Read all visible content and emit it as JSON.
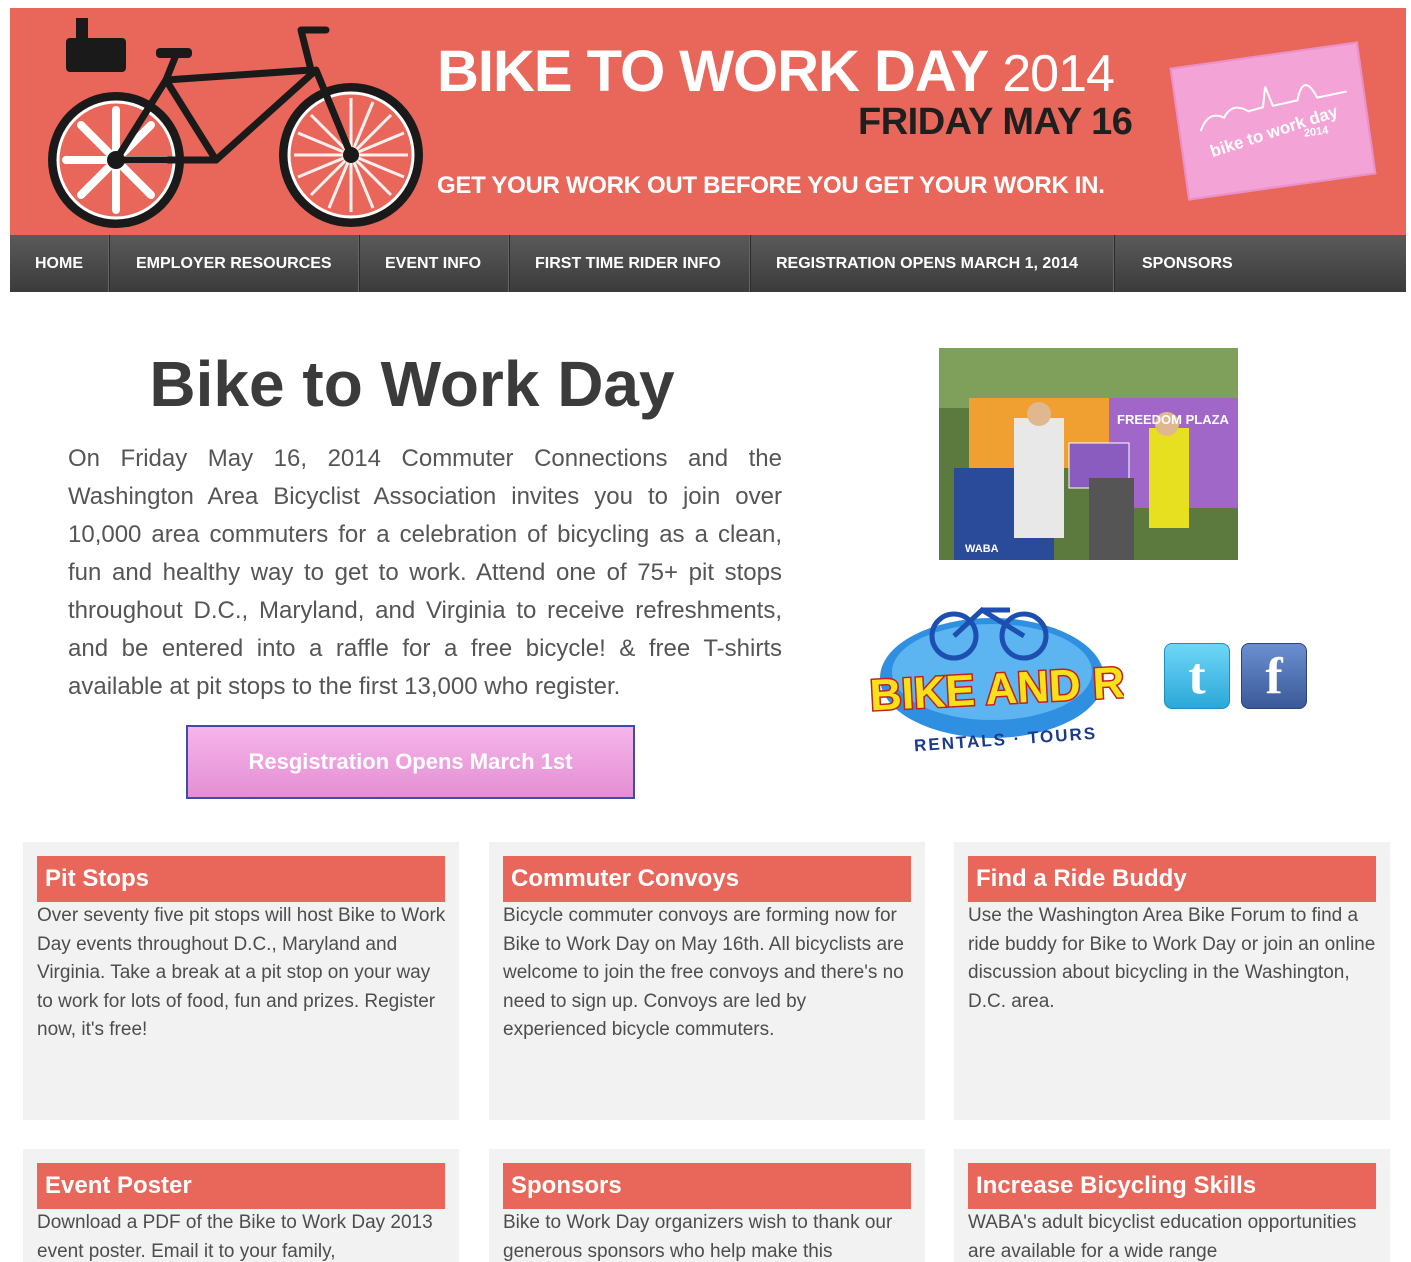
{
  "banner": {
    "title": "BIKE TO WORK DAY",
    "year": "2014",
    "date": "FRIDAY MAY 16",
    "tagline": "GET YOUR WORK OUT BEFORE YOU GET YOUR WORK IN.",
    "flag_text": "bike to work day",
    "flag_year": "2014"
  },
  "nav": {
    "items": [
      {
        "label": "HOME"
      },
      {
        "label": "EMPLOYER RESOURCES"
      },
      {
        "label": "EVENT INFO"
      },
      {
        "label": "FIRST TIME RIDER INFO"
      },
      {
        "label": "REGISTRATION OPENS MARCH 1, 2014"
      },
      {
        "label": "SPONSORS"
      }
    ]
  },
  "main": {
    "title": "Bike to Work Day",
    "intro": "On Friday May 16, 2014 Commuter Connections and the Washington Area Bicyclist Association invites you to join over 10,000 area commuters for a celebration of bicycling as a clean, fun and healthy way to get to work. Attend one of 75+ pit stops throughout D.C., Maryland, and Virginia to receive refreshments, and be entered into a raffle for a free bicycle!  & free T-shirts available at pit stops to the first 13,000 who register.",
    "register_button": "Resgistration Opens March 1st"
  },
  "photo": {
    "sign_text": "FREEDOM PLAZA",
    "banner_text": "WABA"
  },
  "sponsor_logo": {
    "name": "BIKE AND ROLL",
    "sub": "RENTALS · TOURS"
  },
  "social": {
    "twitter_glyph": "t",
    "facebook_glyph": "f"
  },
  "cards": [
    {
      "title": "Pit Stops",
      "body": "Over seventy five pit stops will host Bike to Work Day events throughout D.C., Maryland and Virginia. Take a break at a pit stop on your way to work for lots of food, fun and prizes. Register now, it's free!"
    },
    {
      "title": "Commuter Convoys",
      "body": "Bicycle commuter convoys are forming now for Bike to Work Day on May 16th. All bicyclists are welcome to join the free convoys and there's no need to sign up. Convoys are led by experienced bicycle commuters."
    },
    {
      "title": "Find a Ride Buddy",
      "body": "Use the Washington Area Bike Forum to find a ride buddy for Bike to Work Day or join an online discussion about bicycling in the Washington, D.C. area."
    },
    {
      "title": "Event Poster",
      "body": "Download a PDF of the Bike to Work Day 2013 event poster. Email it to your family,"
    },
    {
      "title": "Sponsors",
      "body": "Bike to Work Day organizers wish to thank our generous sponsors who help make this"
    },
    {
      "title": "Increase Bicycling Skills",
      "body": "WABA's adult bicyclist education opportunities are available for a wide range"
    }
  ],
  "colors": {
    "banner": "#e8675a",
    "nav": "#444444",
    "card_header": "#e8675a",
    "register_button": "#eea2e0"
  }
}
